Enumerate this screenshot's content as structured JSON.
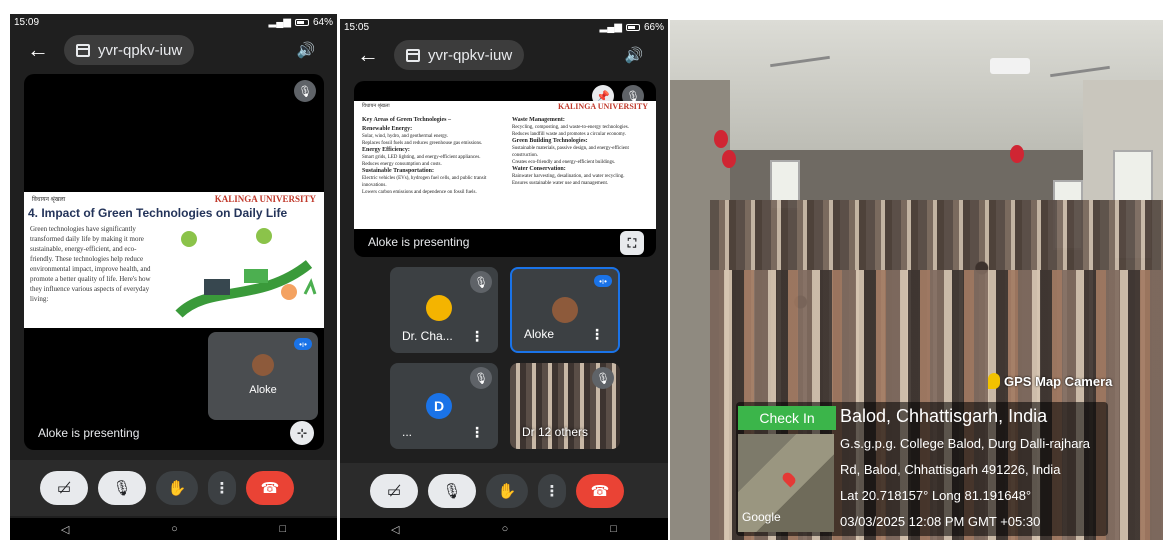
{
  "phone1": {
    "status_time": "15:09",
    "battery": "64%",
    "meeting_code": "yvr-qpkv-iuw",
    "slide": {
      "logos": [
        "विधायन श्रृंखला",
        "KALINGA UNIVERSITY"
      ],
      "title": "4. Impact of Green Technologies on Daily Life",
      "body": "Green technologies have significantly transformed daily life by making it more sustainable, energy-efficient, and eco-friendly. These technologies help reduce environmental impact, improve health, and promote a better quality of life. Here's how they influence various aspects of everyday living:"
    },
    "self_tile": {
      "name": "Aloke"
    },
    "presenting": "Aloke is presenting"
  },
  "phone2": {
    "status_time": "15:05",
    "battery": "66%",
    "meeting_code": "yvr-qpkv-iuw",
    "slide": {
      "left_heading": "Key Areas of Green Technologies –",
      "left_sections": [
        {
          "h": "Renewable Energy:",
          "items": [
            "Solar, wind, hydro, and geothermal energy.",
            "Replaces fossil fuels and reduces greenhouse gas emissions."
          ]
        },
        {
          "h": "Energy Efficiency:",
          "items": [
            "Smart grids, LED lighting, and energy-efficient appliances.",
            "Reduces energy consumption and costs."
          ]
        },
        {
          "h": "Sustainable Transportation:",
          "items": [
            "Electric vehicles (EVs), hydrogen fuel cells, and public transit innovations.",
            "Lowers carbon emissions and dependence on fossil fuels."
          ]
        }
      ],
      "right_sections": [
        {
          "h": "Waste Management:",
          "items": [
            "Recycling, composting, and waste-to-energy technologies.",
            "Reduces landfill waste and promotes a circular economy."
          ]
        },
        {
          "h": "Green Building Technologies:",
          "items": [
            "Sustainable materials, passive design, and energy-efficient construction.",
            "Creates eco-friendly and energy-efficient buildings."
          ]
        },
        {
          "h": "Water Conservation:",
          "items": [
            "Rainwater harvesting, desalination, and water recycling.",
            "Ensures sustainable water use and management."
          ]
        }
      ]
    },
    "presenting": "Aloke is presenting",
    "tiles": [
      {
        "name": "Dr. Cha...",
        "initial": ""
      },
      {
        "name": "Aloke",
        "initial": ""
      },
      {
        "name": "...",
        "initial": "D"
      },
      {
        "name": "Dr 12 others",
        "initial": ""
      }
    ]
  },
  "photo": {
    "app_label": "GPS Map Camera",
    "check_in": "Check In",
    "location": "Balod, Chhattisgarh, India",
    "address_line1": "G.s.g.p.g. College Balod, Durg Dalli-rajhara",
    "address_line2": "Rd, Balod, Chhattisgarh 491226, India",
    "coords": "Lat 20.718157° Long 81.191648°",
    "datetime": "03/03/2025 12:08 PM GMT +05:30",
    "map_brand": "Google"
  },
  "colors": {
    "end_call": "#ea4335",
    "speaking": "#1a73e8",
    "check_in": "#3bb54a"
  }
}
